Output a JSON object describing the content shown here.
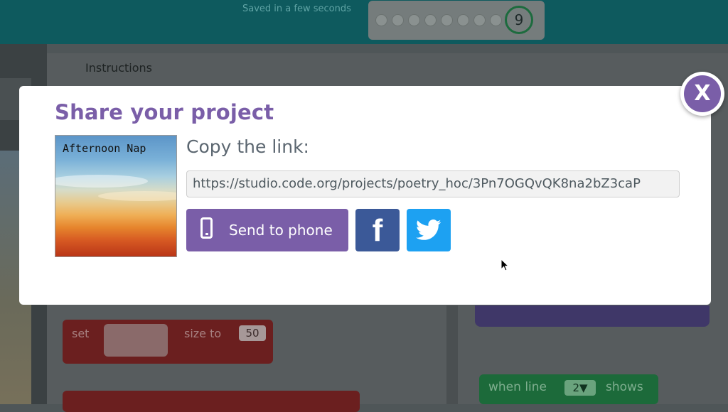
{
  "topbar": {
    "saved_text": "Saved in a few seconds",
    "level_number": "9"
  },
  "workspace": {
    "instructions_tab": "Instructions",
    "set_block": {
      "set_label": "set",
      "size_label": "size to",
      "size_value": "50"
    },
    "when_block": {
      "when_label": "when line",
      "line_value": "2▼",
      "shows_label": "shows"
    }
  },
  "modal": {
    "title": "Share your project",
    "thumbnail_text": "Afternoon Nap",
    "copy_label": "Copy the link:",
    "url": "https://studio.code.org/projects/poetry_hoc/3Pn7OGQvQK8na2bZ3caP",
    "send_to_phone_label": "Send to phone",
    "facebook_letter": "f",
    "close_label": "X"
  },
  "colors": {
    "accent_purple": "#7a5ea8",
    "facebook_blue": "#3b5998",
    "twitter_blue": "#1da1f2",
    "topbar_teal": "#0e5a5e"
  },
  "icons": [
    "phone-icon",
    "facebook-icon",
    "twitter-icon",
    "close-icon",
    "mouse-cursor-icon"
  ]
}
